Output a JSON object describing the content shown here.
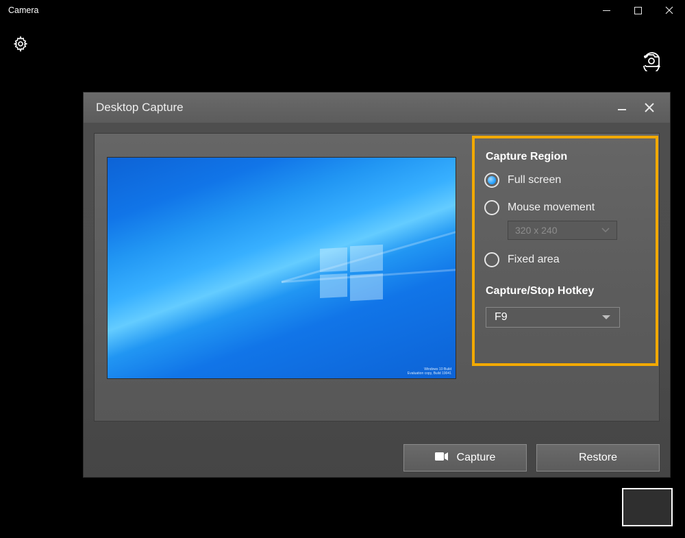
{
  "window": {
    "title": "Camera"
  },
  "dialog": {
    "title": "Desktop Capture",
    "capture_region": {
      "header": "Capture Region",
      "options": {
        "full_screen": "Full screen",
        "mouse_movement": "Mouse movement",
        "fixed_area": "Fixed area"
      },
      "mouse_movement_resolution": "320 x 240"
    },
    "hotkey": {
      "header": "Capture/Stop Hotkey",
      "value": "F9"
    },
    "buttons": {
      "capture": "Capture",
      "restore": "Restore"
    }
  },
  "preview": {
    "watermark_line1": "Windows 10 Build",
    "watermark_line2": "Evaluation copy, Build 19041"
  }
}
